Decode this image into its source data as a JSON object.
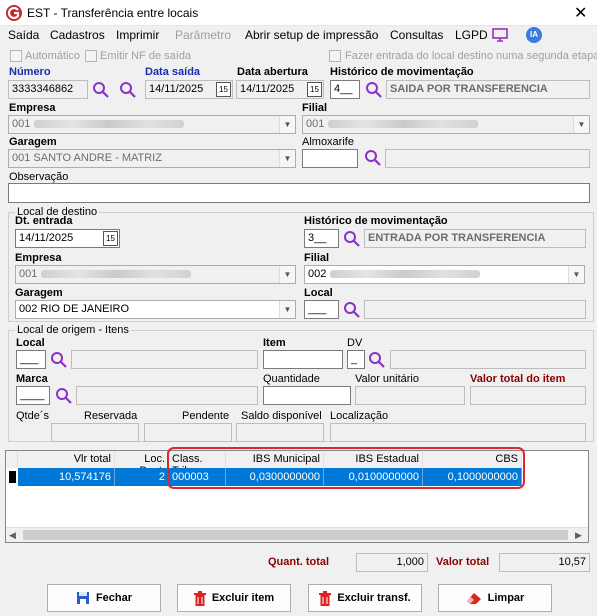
{
  "window": {
    "title": "EST - Transferência entre locais"
  },
  "menu": [
    "Saída",
    "Cadastros",
    "Imprimir",
    "Parâmetro",
    "Abrir setup de impressão",
    "Consultas",
    "LGPD"
  ],
  "menu_ia": "IA",
  "options": {
    "automatico": "Automático",
    "emitir_nf": "Emitir NF de saída",
    "fazer_entrada": "Fazer entrada do local destino numa segunda etapa"
  },
  "header": {
    "numero_label": "Número",
    "numero": "3333346862",
    "data_saida_label": "Data saída",
    "data_saida": "14/11/2025",
    "data_abertura_label": "Data abertura",
    "data_abertura": "14/11/2025",
    "historico_label": "Histórico de movimentação",
    "historico_code": "4__",
    "historico_desc": "SAIDA POR TRANSFERENCIA",
    "empresa_label": "Empresa",
    "empresa": "001",
    "filial_label": "Filial",
    "filial": "001",
    "garagem_label": "Garagem",
    "garagem": "001 SANTO ANDRE - MATRIZ",
    "almoxarife_label": "Almoxarife",
    "observacao_label": "Observação"
  },
  "destino": {
    "title": "Local de destino",
    "dt_entrada_label": "Dt. entrada",
    "dt_entrada": "14/11/2025",
    "historico_label": "Histórico de movimentação",
    "historico_code": "3__",
    "historico_desc": "ENTRADA POR TRANSFERENCIA",
    "empresa_label": "Empresa",
    "empresa": "001",
    "filial_label": "Filial",
    "filial": "002",
    "garagem_label": "Garagem",
    "garagem": "002 RIO DE JANEIRO",
    "local_label": "Local",
    "local": "___"
  },
  "origem": {
    "title": "Local de origem - Itens",
    "local_label": "Local",
    "local": "___",
    "item_label": "Item",
    "dv_label": "DV",
    "dv": "_",
    "marca_label": "Marca",
    "marca": "____",
    "quantidade_label": "Quantidade",
    "valor_unitario_label": "Valor unitário",
    "valor_total_label": "Valor total do item",
    "qtdes_label": "Qtde´s",
    "reservada_label": "Reservada",
    "pendente_label": "Pendente",
    "saldo_label": "Saldo disponível",
    "localizacao_label": "Localização"
  },
  "grid": {
    "columns": [
      "Vlr total",
      "Loc. Dest.",
      "Class. Trib.",
      "IBS Municipal",
      "IBS Estadual",
      "CBS"
    ],
    "rows": [
      [
        "10,574176",
        "2",
        "000003",
        "0,0300000000",
        "0,0100000000",
        "0,1000000000"
      ]
    ]
  },
  "totals": {
    "quant_label": "Quant. total",
    "quant": "1,000",
    "valor_label": "Valor total",
    "valor": "10,57"
  },
  "buttons": {
    "fechar": "Fechar",
    "excluir_item": "Excluir item",
    "excluir_transf": "Excluir transf.",
    "limpar": "Limpar"
  },
  "colors": {
    "selection": "#0078d7",
    "highlight_border": "#d9282f",
    "label_blue": "#1a2bb0",
    "label_red": "#8b0000"
  }
}
